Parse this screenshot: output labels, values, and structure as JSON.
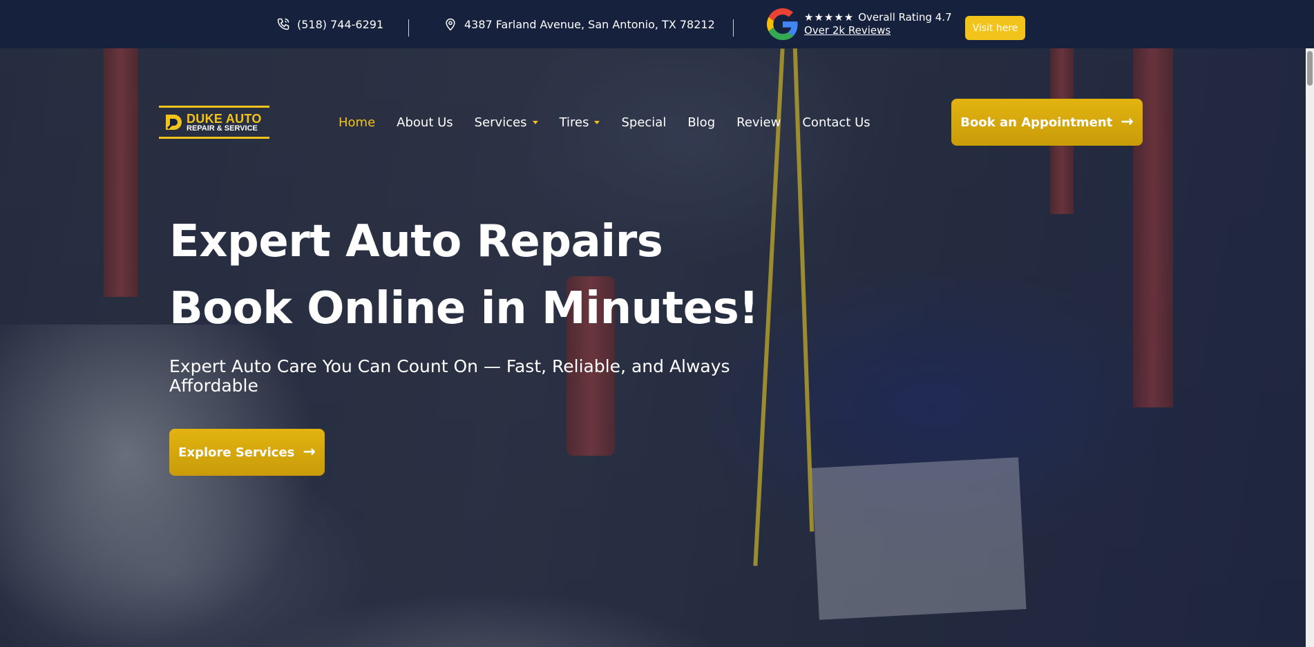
{
  "topbar": {
    "phone": "(518) 744-6291",
    "address": "4387 Farland Avenue, San Antonio, TX 78212",
    "stars": "★★★★★",
    "rating_text": "Overall Rating 4.7",
    "reviews_link": "Over 2k Reviews",
    "visit_button": "Visit here"
  },
  "logo": {
    "line1": "DUKE AUTO",
    "line2": "REPAIR & SERVICE"
  },
  "nav": {
    "items": [
      {
        "label": "Home",
        "active": true
      },
      {
        "label": "About Us"
      },
      {
        "label": "Services",
        "dropdown": true
      },
      {
        "label": "Tires",
        "dropdown": true
      },
      {
        "label": "Special"
      },
      {
        "label": "Blog"
      },
      {
        "label": "Review"
      },
      {
        "label": "Contact Us"
      }
    ],
    "cta": "Book an Appointment"
  },
  "hero": {
    "title": "Expert Auto Repairs Book Online in Minutes!",
    "subtitle": "Expert Auto Care You Can Count On — Fast, Reliable, and Always Affordable",
    "button": "Explore Services"
  },
  "colors": {
    "topbar_bg": "#16213e",
    "accent": "#f2c31a",
    "button_gold": "#d4a60d"
  },
  "icons": {
    "phone": "phone-icon",
    "location": "location-pin-icon",
    "google": "google-icon",
    "arrow": "arrow-right-icon"
  }
}
